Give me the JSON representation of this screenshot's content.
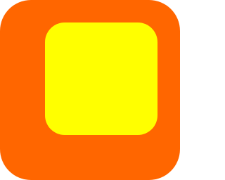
{
  "icon": {
    "name": "stop-square-icon",
    "colors": {
      "background": "#FF6600",
      "square": "#FFFF00"
    }
  }
}
